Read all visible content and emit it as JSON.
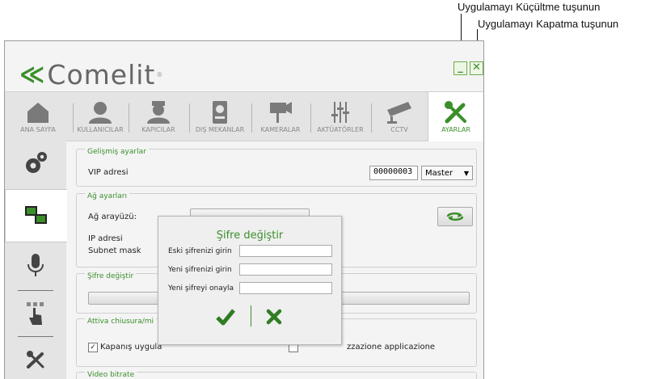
{
  "callouts": {
    "minimize": "Uygulamayı Küçültme tuşunun",
    "close": "Uygulamayı Kapatma tuşunun"
  },
  "app": {
    "brand": "Comelit",
    "window_buttons": {
      "minimize_glyph": "_",
      "close_glyph": "✕"
    }
  },
  "tabs": [
    {
      "label": "ANA SAYFA",
      "icon": "home-icon",
      "active": false
    },
    {
      "label": "KULLANICILAR",
      "icon": "user-icon",
      "active": false
    },
    {
      "label": "KAPICILAR",
      "icon": "concierge-icon",
      "active": false
    },
    {
      "label": "DIŞ MEKANLAR",
      "icon": "entrance-panel-icon",
      "active": false
    },
    {
      "label": "KAMERALAR",
      "icon": "camera-icon",
      "active": false
    },
    {
      "label": "AKTÜATÖRLER",
      "icon": "actuator-icon",
      "active": false
    },
    {
      "label": "CCTV",
      "icon": "cctv-icon",
      "active": false
    },
    {
      "label": "AYARLAR",
      "icon": "tools-icon",
      "active": true
    }
  ],
  "sidebar": {
    "items": [
      {
        "icon": "gears-icon",
        "active": false
      },
      {
        "icon": "network-icon",
        "active": true
      },
      {
        "icon": "microphone-icon",
        "active": false
      },
      {
        "icon": "touch-icon",
        "active": false
      },
      {
        "icon": "tools-icon",
        "active": false
      }
    ]
  },
  "settings": {
    "advanced": {
      "title": "Gelişmiş ayarlar",
      "vip_label": "VIP adresi",
      "vip_value": "00000003",
      "mode_value": "Master"
    },
    "network": {
      "title": "Ağ ayarları",
      "interface_label": "Ağ arayüzü:",
      "ip_label": "IP adresi",
      "subnet_label": "Subnet mask"
    },
    "password": {
      "title": "Şifre değiştir"
    },
    "minimize": {
      "title": "Attiva chiusura/mi",
      "checkbox_left": "Kapanış uygula",
      "checkbox_right": "zzazione applicazione",
      "checkbox_mark": "✓"
    },
    "video": {
      "title": "Video bitrate"
    }
  },
  "dialog": {
    "title": "Şifre değiştir",
    "old_label": "Eski şifrenizi girin",
    "new_label": "Yeni şifrenizi girin",
    "confirm_label": "Yeni şifreyi onayla"
  },
  "colors": {
    "accent": "#3a8f2a",
    "icon_gray": "#7a7a7a"
  }
}
